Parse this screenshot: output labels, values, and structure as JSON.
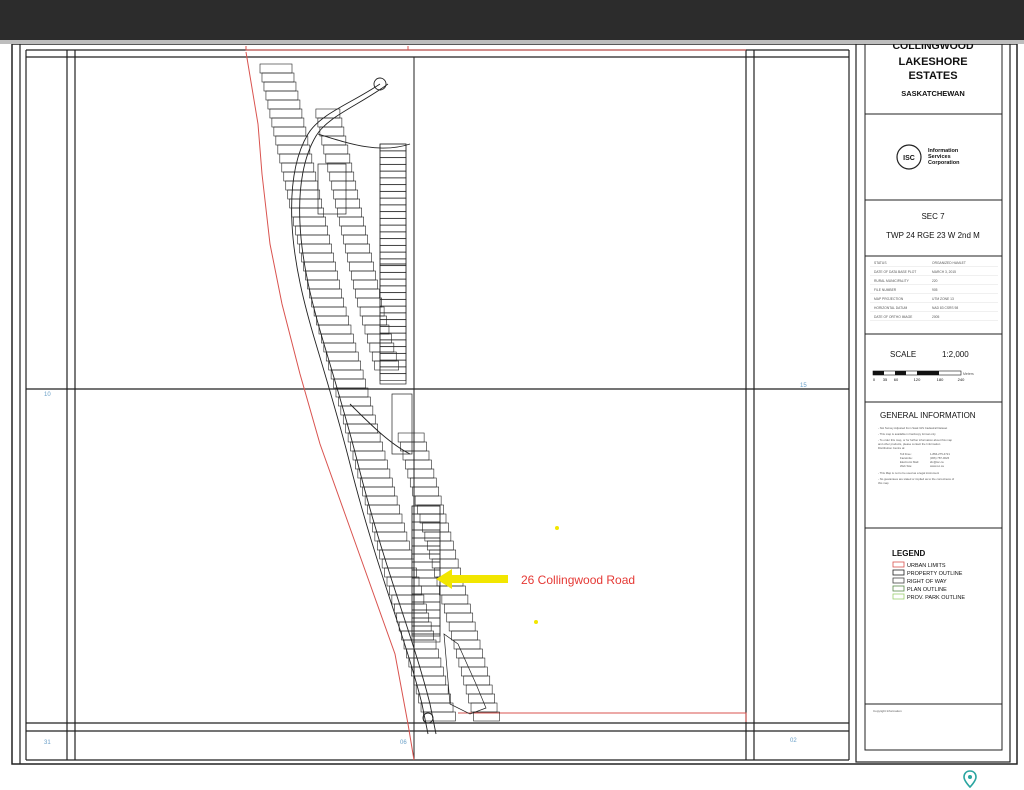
{
  "title_block": {
    "line1": "COLLINGWOOD",
    "line2": "LAKESHORE",
    "line3": "ESTATES",
    "province": "SASKATCHEWAN"
  },
  "isc": {
    "logo_text": "ISC",
    "line1": "Information",
    "line2": "Services",
    "line3": "Corporation"
  },
  "section": {
    "sec": "SEC 7",
    "twp": "TWP 24 RGE 23 W 2nd M"
  },
  "info_rows": [
    {
      "label": "STATUS",
      "value": "ORGANIZED HAMLET"
    },
    {
      "label": "DATE OF DATA BASE PLOT",
      "value": "MARCH 3, 2015"
    },
    {
      "label": "RURAL MUNICIPALITY",
      "value": "220"
    },
    {
      "label": "FILE NUMBER",
      "value": "905"
    },
    {
      "label": "MAP PROJECTION",
      "value": "UTM ZONE 13"
    },
    {
      "label": "HORIZONTAL DATUM",
      "value": "NAD 83 CSRS 98"
    },
    {
      "label": "DATE OF ORTHO IMAGE",
      "value": "2005"
    }
  ],
  "scale": {
    "label": "SCALE",
    "value": "1:2,000",
    "ticks": [
      "0",
      "35",
      "60",
      "120",
      "180",
      "240"
    ],
    "unit": "Meters"
  },
  "general": {
    "heading": "GENERAL INFORMATION",
    "notes": [
      "- Not Survey Adjusted from Sask GIS Cadastral Dataset",
      "- This map is available in hardcopy format only",
      "- To order this map, or for further information about this map and other products, please contact the Information Distribution Centre at:",
      "- This Map is not to be used as a legal instrument",
      "- No guarantees are stated or implied as to the correctness of this map"
    ],
    "contacts": [
      {
        "label": "Toll Free:",
        "value": "1-866-275-4721"
      },
      {
        "label": "Facsimile:",
        "value": "(306) 787-0026"
      },
      {
        "label": "Electronic Mail:",
        "value": "idc@isc.ca"
      },
      {
        "label": "Web Site:",
        "value": "www.isc.ca"
      }
    ]
  },
  "legend": {
    "heading": "LEGEND",
    "items": [
      {
        "label": "URBAN LIMITS",
        "color": "#d9534f"
      },
      {
        "label": "PROPERTY OUTLINE",
        "color": "#222222"
      },
      {
        "label": "RIGHT OF WAY",
        "color": "#444444"
      },
      {
        "label": "PLAN OUTLINE",
        "color": "#5a8a4a"
      },
      {
        "label": "PROV. PARK OUTLINE",
        "color": "#9bcf6e"
      }
    ]
  },
  "annotation": {
    "text": "26 Collingwood Road",
    "text_color": "#e53935",
    "arrow_color": "#f2e600"
  },
  "footer_copyright": "Copyright Information",
  "colors": {
    "urban_limits": "#d9534f",
    "grid_line": "#222222",
    "minor_text": "#6aa0c8"
  },
  "icons": {
    "location": "map-pin-icon"
  }
}
